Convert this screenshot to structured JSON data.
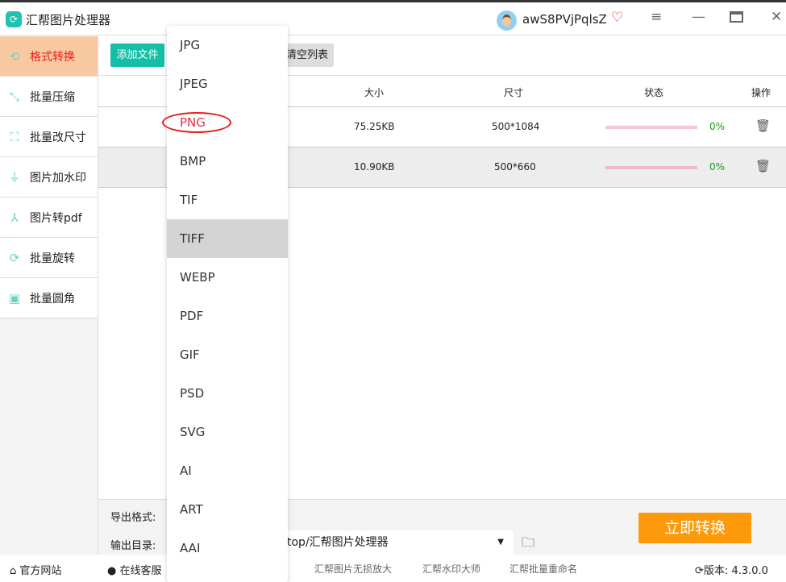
{
  "app": {
    "title": "汇帮图片处理器",
    "username": "awS8PVjPqlsZ"
  },
  "sidebar": {
    "items": [
      {
        "label": "格式转换",
        "icon": "convert-icon"
      },
      {
        "label": "批量压缩",
        "icon": "compress-icon"
      },
      {
        "label": "批量改尺寸",
        "icon": "resize-icon"
      },
      {
        "label": "图片加水印",
        "icon": "watermark-icon"
      },
      {
        "label": "图片转pdf",
        "icon": "pdf-icon"
      },
      {
        "label": "批量旋转",
        "icon": "rotate-icon"
      },
      {
        "label": "批量圆角",
        "icon": "image-icon"
      }
    ]
  },
  "toolbar": {
    "add": "添加文件",
    "clear": "清空列表"
  },
  "table": {
    "headers": {
      "size": "大小",
      "dims": "尺寸",
      "status": "状态",
      "action": "操作"
    },
    "rows": [
      {
        "size": "75.25KB",
        "dims": "500*1084",
        "progress": 0,
        "pct": "0%"
      },
      {
        "size": "10.90KB",
        "dims": "500*660",
        "progress": 0,
        "pct": "0%"
      }
    ]
  },
  "bottom": {
    "format_label": "导出格式:",
    "dir_label": "输出目录:",
    "dir_value": "top/汇帮图片处理器",
    "convert": "立即转换"
  },
  "footer": {
    "site": "官方网站",
    "service": "在线客服",
    "links": [
      "汇帮图片无损放大",
      "汇帮水印大师",
      "汇帮批量重命名"
    ],
    "version_label": "版本:",
    "version": "4.3.0.0"
  },
  "dropdown": {
    "options": [
      "JPG",
      "JPEG",
      "PNG",
      "BMP",
      "TIF",
      "TIFF",
      "WEBP",
      "PDF",
      "GIF",
      "PSD",
      "SVG",
      "AI",
      "ART",
      "AAI"
    ],
    "selected": "PNG",
    "hovered": "TIFF"
  },
  "colors": {
    "accent": "#13bfa6",
    "active_bg": "#f8c9a0",
    "convert": "#fc9a0c"
  }
}
